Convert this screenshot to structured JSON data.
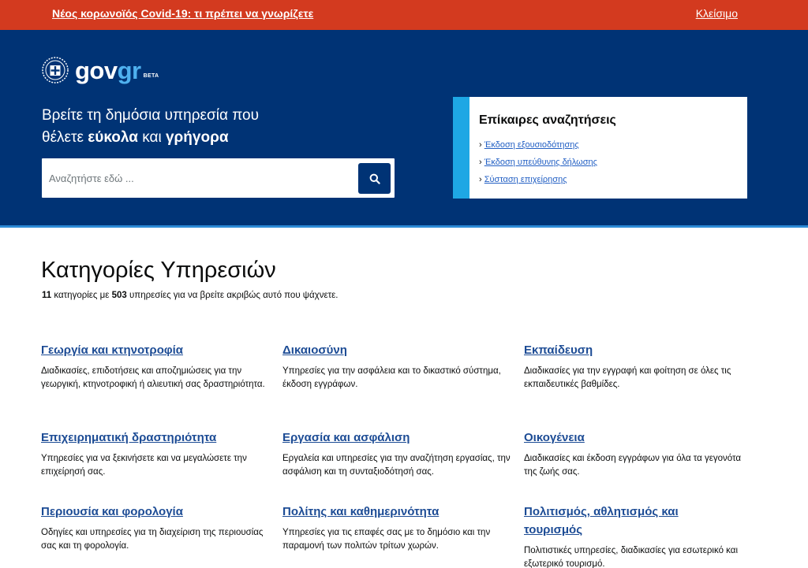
{
  "alert": {
    "message": "Νέος κορωνοϊός Covid-19: τι πρέπει να γνωρίζετε",
    "close_label": "Κλείσιμο"
  },
  "logo": {
    "text_gov": "gov",
    "text_gr": "gr",
    "beta": "BETA"
  },
  "hero": {
    "heading_line1": "Βρείτε τη δημόσια υπηρεσία που",
    "heading_prefix": "θέλετε ",
    "heading_bold1": "εύκολα",
    "heading_middle": " και ",
    "heading_bold2": "γρήγορα",
    "search_placeholder": "Αναζητήστε εδώ ..."
  },
  "popular": {
    "title": "Επίκαιρες αναζητήσεις",
    "items": [
      {
        "label": "Έκδοση εξουσιοδότησης"
      },
      {
        "label": "Έκδοση υπεύθυνης δήλωσης"
      },
      {
        "label": "Σύσταση επιχείρησης"
      }
    ]
  },
  "categories_section": {
    "title": "Κατηγορίες Υπηρεσιών",
    "count_categories": "11",
    "summary_middle": " κατηγορίες με ",
    "count_services": "503",
    "summary_end": " υπηρεσίες για να βρείτε ακριβώς αυτό που ψάχνετε.",
    "items": [
      {
        "title": "Γεωργία και κτηνοτροφία",
        "description": "Διαδικασίες, επιδοτήσεις και αποζημιώσεις για την γεωργική, κτηνοτροφική ή αλιευτική σας δραστηριότητα."
      },
      {
        "title": "Δικαιοσύνη",
        "description": "Υπηρεσίες για την ασφάλεια και το δικαστικό σύστημα, έκδοση εγγράφων."
      },
      {
        "title": "Εκπαίδευση",
        "description": "Διαδικασίες για την εγγραφή και φοίτηση σε όλες τις εκπαιδευτικές βαθμίδες."
      },
      {
        "title": "Επιχειρηματική δραστηριότητα",
        "description": "Υπηρεσίες για να ξεκινήσετε και να μεγαλώσετε την επιχείρησή σας."
      },
      {
        "title": "Εργασία και ασφάλιση",
        "description": "Εργαλεία και υπηρεσίες για την αναζήτηση εργασίας, την ασφάλιση και τη συνταξιοδότησή σας."
      },
      {
        "title": "Οικογένεια",
        "description": "Διαδικασίες και έκδοση εγγράφων για όλα τα γεγονότα της ζωής σας."
      },
      {
        "title": "Περιουσία και φορολογία",
        "description": "Οδηγίες και υπηρεσίες για τη διαχείριση της περιουσίας σας και τη φορολογία."
      },
      {
        "title": "Πολίτης και καθημερινότητα",
        "description": "Υπηρεσίες για τις επαφές σας με το δημόσιο και την παραμονή των πολιτών τρίτων χωρών."
      },
      {
        "title": "Πολιτισμός, αθλητισμός και τουρισμός",
        "description": "Πολιτιστικές υπηρεσίες, διαδικασίες για εσωτερικό και εξωτερικό τουρισμό."
      }
    ]
  },
  "colors": {
    "alert_bg": "#d33a1f",
    "hero_bg": "#003375",
    "accent_light_blue": "#1ea7e4",
    "link_blue": "#1d4c95"
  },
  "icons": {
    "search": "search-icon",
    "emblem": "greek-emblem-icon"
  }
}
